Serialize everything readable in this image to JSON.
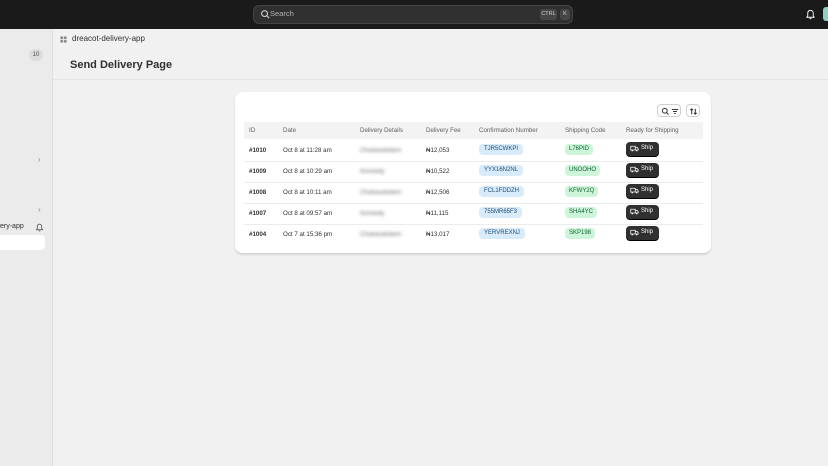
{
  "topbar": {
    "search_placeholder": "Search",
    "shortcut_ctrl": "CTRL",
    "shortcut_key": "K",
    "avatar_color": "#91d0c1"
  },
  "sidebar": {
    "badge_count": "10",
    "app_item_label": "ery-app"
  },
  "breadcrumb": "dreacot-delivery-app",
  "page_title": "Send Delivery Page",
  "table": {
    "columns": [
      "ID",
      "Date",
      "Delivery Details",
      "Delivery Fee",
      "Confirmation Number",
      "Shipping Code",
      "Ready for Shipping"
    ],
    "rows": [
      {
        "id": "#1010",
        "date": "Oct 8 at 11:28 am",
        "details": "Chukwudubem",
        "fee": "₦12,053",
        "confirmation": "TJR5CWKPI",
        "shipping": "L76PID",
        "action": "Ship"
      },
      {
        "id": "#1009",
        "date": "Oct 8 at 10:29 am",
        "details": "Kennedy",
        "fee": "₦10,522",
        "confirmation": "YYX16N2NL",
        "shipping": "UNOOHO",
        "action": "Ship"
      },
      {
        "id": "#1008",
        "date": "Oct 8 at 10:11 am",
        "details": "Chukwudubem",
        "fee": "₦12,506",
        "confirmation": "FCL1FDDZH",
        "shipping": "KFWY2Q",
        "action": "Ship"
      },
      {
        "id": "#1007",
        "date": "Oct 8 at 09:57 am",
        "details": "Kennedy",
        "fee": "₦11,115",
        "confirmation": "755MR65F3",
        "shipping": "SHA4YC",
        "action": "Ship"
      },
      {
        "id": "#1004",
        "date": "Oct 7 at 15:36 pm",
        "details": "Chukwudubem",
        "fee": "₦13,017",
        "confirmation": "YERVREXNJ",
        "shipping": "SKP198",
        "action": "Ship"
      }
    ]
  },
  "colors": {
    "topbar": "#1a1a1a",
    "confirmation_badge": "#d7ebfb",
    "shipping_badge": "#cdf5d9",
    "ship_button": "#303030"
  }
}
